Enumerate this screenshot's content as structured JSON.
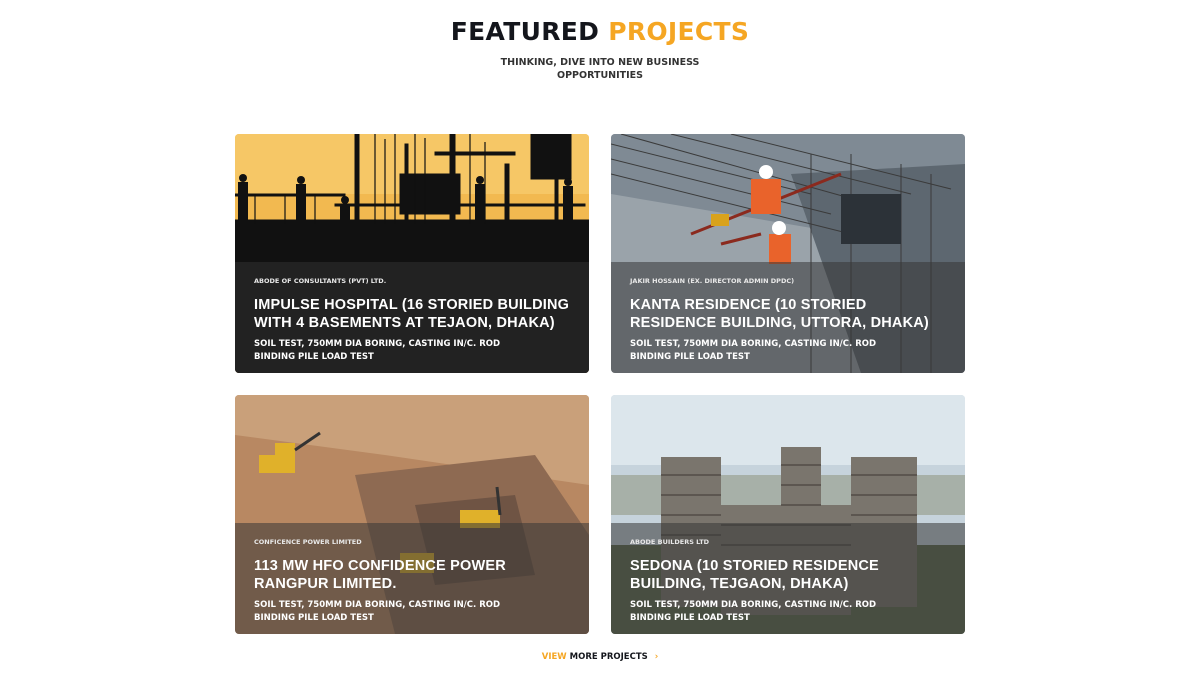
{
  "header": {
    "title_main": "FEATURED",
    "title_accent": "PROJECTS",
    "subtitle": "THINKING, DIVE INTO NEW BUSINESS OPPORTUNITIES"
  },
  "projects": [
    {
      "client": "ABODE OF CONSULTANTS (PVT) LTD.",
      "title": "IMPULSE HOSPITAL (16 STORIED BUILDING WITH 4 BASEMENTS AT TEJAON, DHAKA)",
      "description": "SOIL TEST, 750MM DIA BORING, CASTING IN/C. ROD BINDING PILE LOAD TEST"
    },
    {
      "client": "JAKIR HOSSAIN (EX. DIRECTOR ADMIN DPDC)",
      "title": "KANTA RESIDENCE (10 STORIED RESIDENCE BUILDING, UTTORA, DHAKA)",
      "description": "SOIL TEST, 750MM DIA BORING, CASTING IN/C. ROD BINDING PILE LOAD TEST"
    },
    {
      "client": "CONFICENCE POWER LIMITED",
      "title": "113 MW HFO CONFIDENCE POWER RANGPUR LIMITED.",
      "description": "SOIL TEST, 750MM DIA BORING, CASTING IN/C. ROD BINDING PILE LOAD TEST"
    },
    {
      "client": "ABODE BUILDERS LTD",
      "title": "SEDONA (10 STORIED RESIDENCE BUILDING, TEJGAON, DHAKA)",
      "description": "SOIL TEST, 750MM DIA BORING, CASTING IN/C. ROD BINDING PILE LOAD TEST"
    }
  ],
  "view_more": {
    "word_view": "VIEW",
    "rest": "MORE PROJECTS",
    "arrow": "›"
  },
  "colors": {
    "accent": "#f5a623",
    "dark": "#14161c"
  }
}
